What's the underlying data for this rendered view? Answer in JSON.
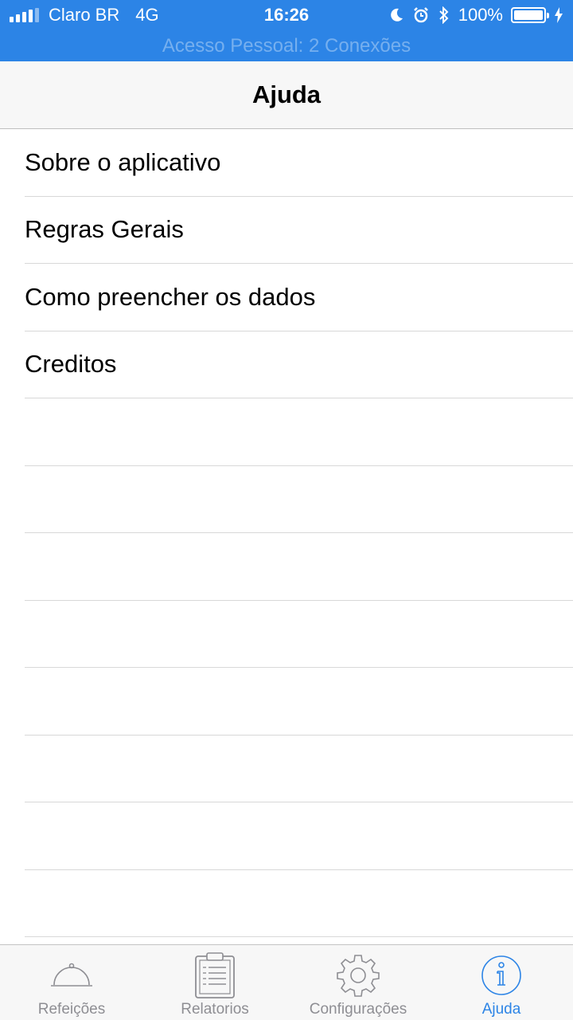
{
  "status_bar": {
    "carrier": "Claro BR",
    "network": "4G",
    "time": "16:26",
    "battery": "100%",
    "connections_banner": "Acesso Pessoal: 2 Conexões"
  },
  "nav": {
    "title": "Ajuda"
  },
  "list": {
    "items": [
      {
        "label": "Sobre o aplicativo"
      },
      {
        "label": "Regras Gerais"
      },
      {
        "label": "Como preencher os dados"
      },
      {
        "label": "Creditos"
      }
    ]
  },
  "tabs": [
    {
      "label": "Refeições",
      "icon": "cloche-icon",
      "active": false
    },
    {
      "label": "Relatorios",
      "icon": "clipboard-icon",
      "active": false
    },
    {
      "label": "Configurações",
      "icon": "gear-icon",
      "active": false
    },
    {
      "label": "Ajuda",
      "icon": "info-icon",
      "active": true
    }
  ],
  "colors": {
    "accent": "#2c84e6",
    "inactive": "#8e8e93"
  }
}
